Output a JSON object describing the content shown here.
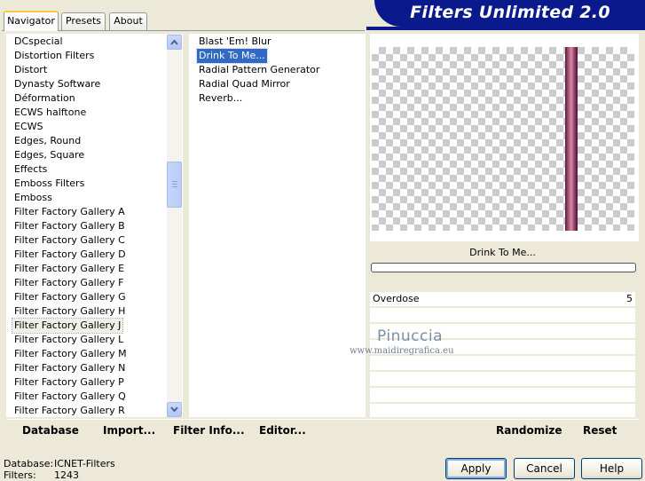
{
  "tabs": [
    {
      "label": "Navigator",
      "active": true
    },
    {
      "label": "Presets",
      "active": false
    },
    {
      "label": "About",
      "active": false
    }
  ],
  "banner_title": "Filters Unlimited 2.0",
  "categories": [
    "DCspecial",
    "Distortion Filters",
    "Distort",
    "Dynasty Software",
    "Déformation",
    "ECWS halftone",
    "ECWS",
    "Edges, Round",
    "Edges, Square",
    "Effects",
    "Emboss Filters",
    "Emboss",
    "Filter Factory Gallery A",
    "Filter Factory Gallery B",
    "Filter Factory Gallery C",
    "Filter Factory Gallery D",
    "Filter Factory Gallery E",
    "Filter Factory Gallery F",
    "Filter Factory Gallery G",
    "Filter Factory Gallery H",
    "Filter Factory Gallery J",
    "Filter Factory Gallery L",
    "Filter Factory Gallery M",
    "Filter Factory Gallery N",
    "Filter Factory Gallery P",
    "Filter Factory Gallery Q",
    "Filter Factory Gallery R"
  ],
  "selected_category": "Filter Factory Gallery J",
  "filters": [
    "Blast 'Em! Blur",
    "Drink To Me...",
    "Radial Pattern Generator",
    "Radial Quad Mirror",
    "Reverb..."
  ],
  "selected_filter": "Drink To Me...",
  "preview_label": "Drink To Me...",
  "parameter": {
    "name": "Overdose",
    "value": "5"
  },
  "bottom_bar": {
    "database": "Database",
    "import": "Import...",
    "filter_info": "Filter Info...",
    "editor": "Editor...",
    "randomize": "Randomize",
    "reset": "Reset"
  },
  "info": {
    "database_label": "Database:",
    "database_value": "ICNET-Filters",
    "filters_label": "Filters:",
    "filters_value": "1243"
  },
  "buttons": {
    "apply": "Apply",
    "cancel": "Cancel",
    "help": "Help"
  },
  "watermark": {
    "name": "Pinuccia",
    "url": "www.maidiregrafica.eu"
  },
  "colors": {
    "banner": "#0a1a8c",
    "selection": "#316ac5",
    "background": "#ece9d8"
  },
  "icons": {
    "scroll_up": "chevron-up-icon",
    "scroll_down": "chevron-down-icon"
  }
}
